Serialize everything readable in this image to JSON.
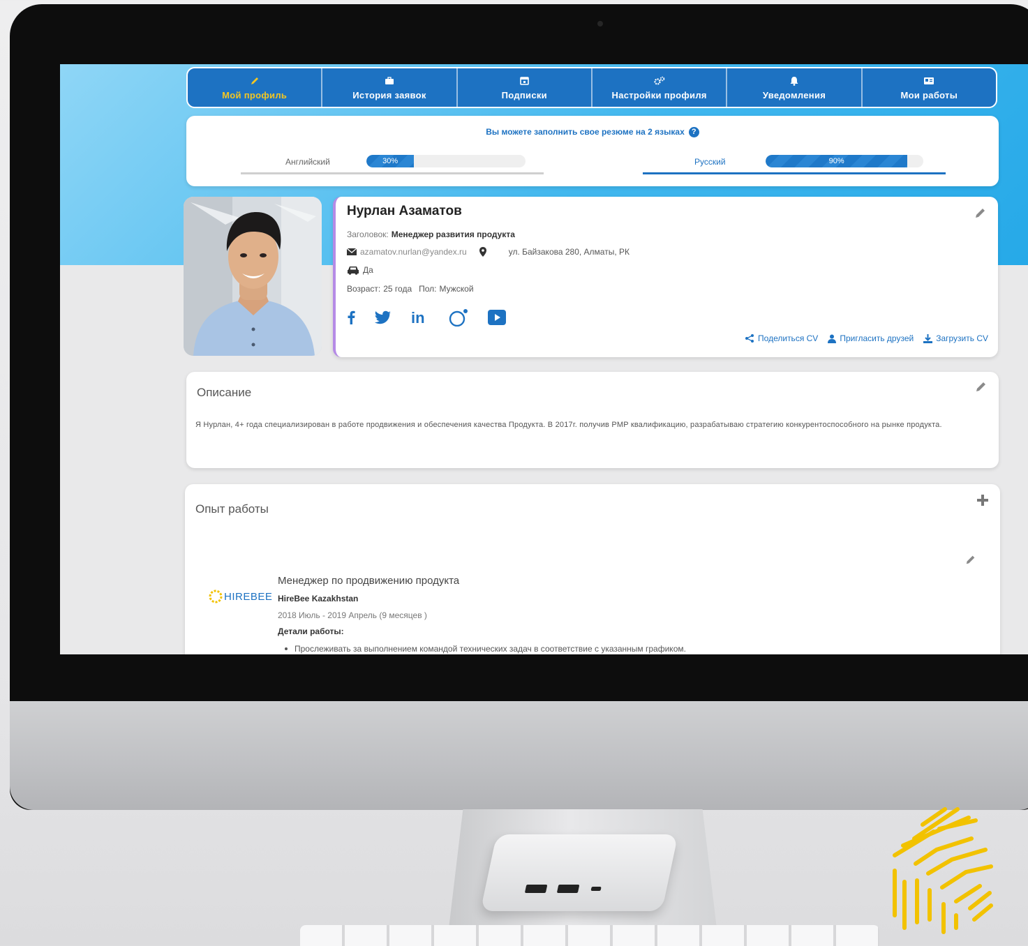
{
  "nav": {
    "tabs": [
      {
        "label": "Мой профиль",
        "icon": "pencil-icon",
        "active": true
      },
      {
        "label": "История заявок",
        "icon": "briefcase-icon",
        "active": false
      },
      {
        "label": "Подписки",
        "icon": "calendar-icon",
        "active": false
      },
      {
        "label": "Настройки профиля",
        "icon": "gears-icon",
        "active": false
      },
      {
        "label": "Уведомления",
        "icon": "bell-icon",
        "active": false
      },
      {
        "label": "Мои работы",
        "icon": "id-card-icon",
        "active": false
      }
    ]
  },
  "languages": {
    "note": "Вы можете заполнить свое резюме на 2 языках",
    "help": "?",
    "items": [
      {
        "label": "Английский",
        "progress_text": "30%",
        "progress": 0.3,
        "active": false
      },
      {
        "label": "Русский",
        "progress_text": "90%",
        "progress": 0.9,
        "active": true
      }
    ]
  },
  "profile": {
    "name": "Нурлан Азаматов",
    "headline_label": "Заголовок:",
    "headline": "Менеджер развития продукта",
    "email": "azamatov.nurlan@yandex.ru",
    "address": "ул. Байзакова 280, Алматы, РК",
    "car": "Да",
    "age_label": "Возраст:",
    "age": "25 года",
    "gender_label": "Пол:",
    "gender": "Мужской",
    "socials": [
      "facebook-icon",
      "twitter-icon",
      "linkedin-icon",
      "instagram-icon",
      "youtube-icon"
    ],
    "actions": {
      "share": "Поделиться CV",
      "invite": "Пригласить друзей",
      "download": "Загрузить CV"
    }
  },
  "description": {
    "title": "Описание",
    "text": "Я Нурлан, 4+ года специализирован в работе продвижения и обеспечения качества Продукта. В 2017г. получив PMP квалификацию, разрабатываю стратегию конкурентоспособного на рынке продукта."
  },
  "experience": {
    "title": "Опыт работы",
    "items": [
      {
        "logo_text": "HIREBEE",
        "role": "Менеджер по продвижению продукта",
        "company": "HireBee Kazakhstan",
        "dates": "2018 Июль  - 2019 Апрель (9 месяцев )",
        "details_label": "Детали работы:",
        "bullets": [
          "Прослеживать за выполнением командой технических задач в соответствие с указанным графиком."
        ]
      }
    ]
  },
  "colors": {
    "primary": "#1d72c2",
    "active_tab": "#f3c623",
    "hero": "#26a9e8",
    "brand_gold": "#f2c200"
  }
}
